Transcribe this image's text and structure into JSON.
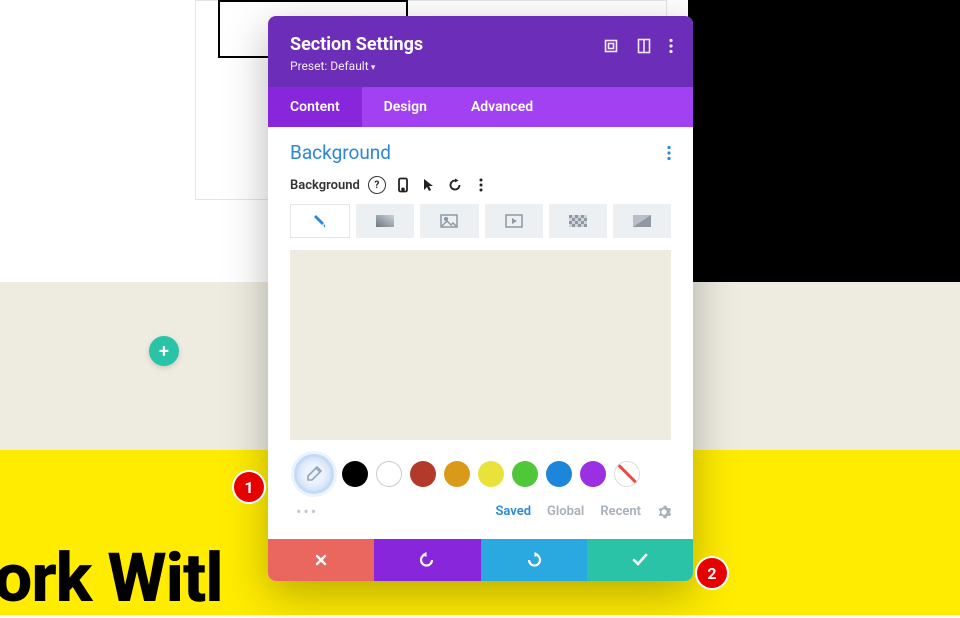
{
  "page": {
    "hero_text": "ork Witl"
  },
  "fab": {
    "add": "+"
  },
  "modal": {
    "title": "Section Settings",
    "preset": "Preset: Default",
    "tabs": {
      "content": "Content",
      "design": "Design",
      "advanced": "Advanced"
    },
    "section": {
      "title": "Background",
      "label": "Background"
    },
    "palette": {
      "swatches": [
        "#000000",
        "#ffffff",
        "#b33a2b",
        "#d99a1a",
        "#e9e23a",
        "#4ec739",
        "#1c86d9",
        "#9b2fe2"
      ],
      "footer": {
        "saved": "Saved",
        "global": "Global",
        "recent": "Recent"
      }
    }
  },
  "markers": {
    "one": "1",
    "two": "2"
  }
}
